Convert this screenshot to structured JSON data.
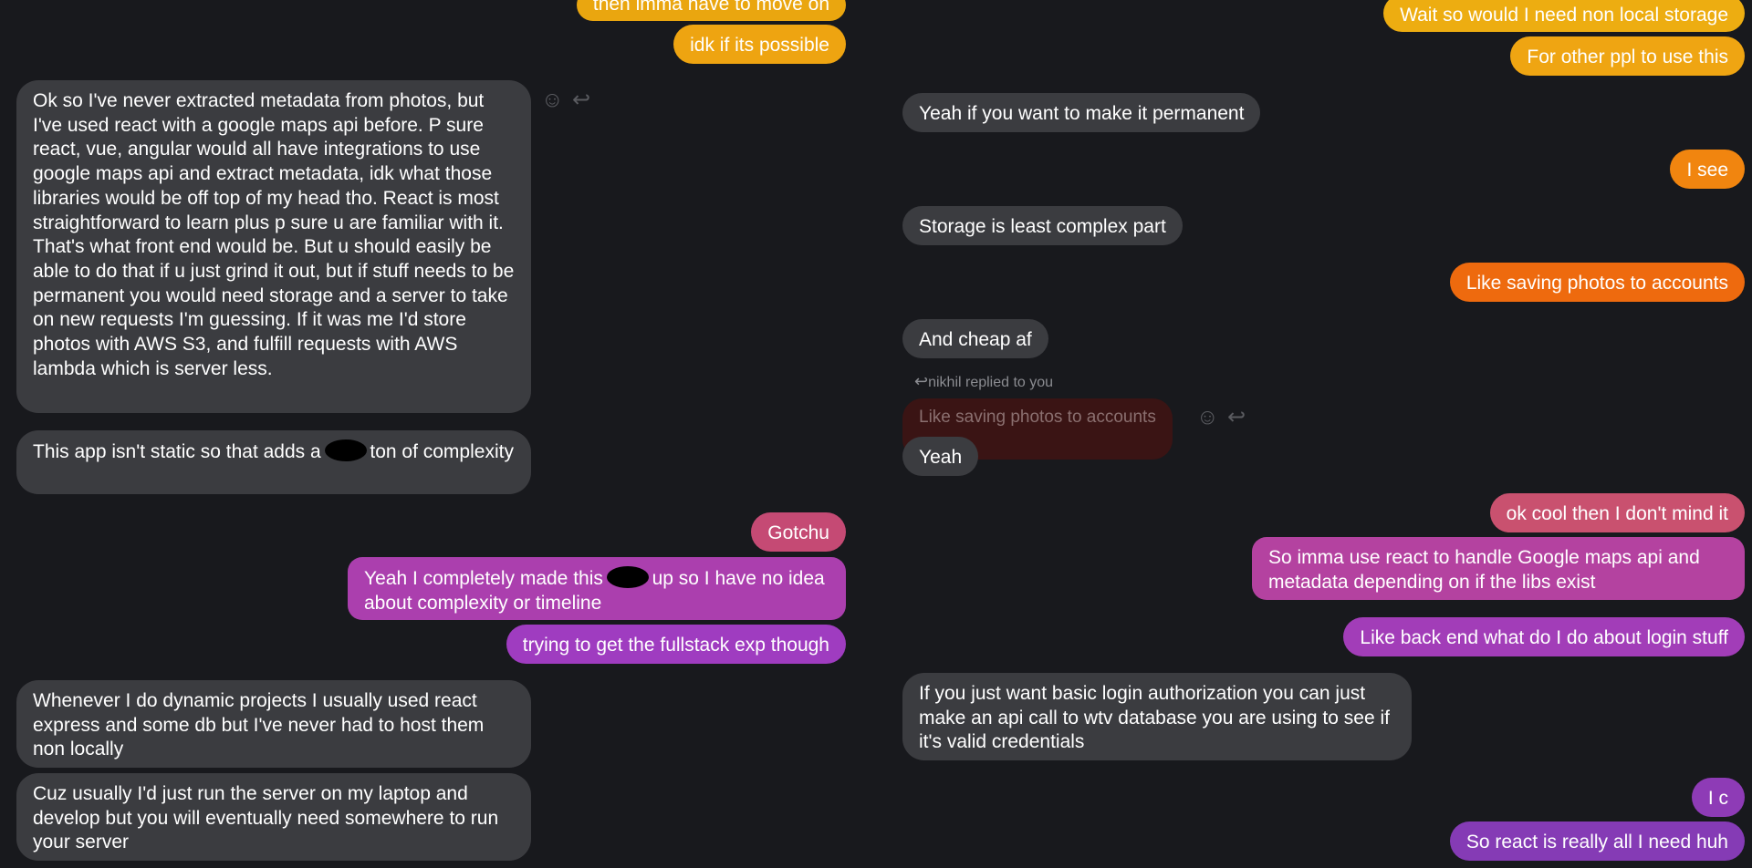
{
  "left_column": {
    "messages": [
      {
        "id": "l1",
        "direction": "out",
        "text": "then imma have to move on",
        "color": "#eaa60f"
      },
      {
        "id": "l2",
        "direction": "out",
        "text": "idk if its possible",
        "color": "#eea411"
      },
      {
        "id": "l3",
        "direction": "in",
        "text": "Ok so I've never extracted metadata from photos, but I've used react with a google maps api before. P sure react, vue, angular would all have integrations to use google maps api and extract metadata, idk what those libraries would be off top of my head tho. React is most straightforward to learn plus p sure u are familiar with it. That's what front end would be. But u should easily be able to do that if u just grind it out, but if stuff needs to be permanent you would need storage and a server to take on new requests I'm guessing. If it was me I'd store photos with AWS S3, and fulfill requests with AWS lambda which is server less."
      },
      {
        "id": "l4",
        "direction": "in",
        "text_before": "This app isn't static so that adds a",
        "text_after": "ton of complexity"
      },
      {
        "id": "l5",
        "direction": "out",
        "text": "Gotchu",
        "color": "#c54a74"
      },
      {
        "id": "l6",
        "direction": "out",
        "text_before": "Yeah I completely made this",
        "text_after": "up so I have no idea about complexity or timeline",
        "color": "#ab3fae"
      },
      {
        "id": "l7",
        "direction": "out",
        "text": "trying to get the fullstack exp though",
        "color": "#9f3cc0"
      },
      {
        "id": "l8",
        "direction": "in",
        "text": "Whenever I do dynamic projects I usually used react express and some db but I've never had to host them non locally"
      },
      {
        "id": "l9",
        "direction": "in",
        "text": "Cuz usually I'd just run the server on my laptop and develop but you will eventually need somewhere to run your server"
      }
    ]
  },
  "right_column": {
    "messages": [
      {
        "id": "r1",
        "direction": "out",
        "text": "Wait so would I need non local storage",
        "color": "#edad11"
      },
      {
        "id": "r2",
        "direction": "out",
        "text": "For other ppl to use this",
        "color": "#efa512"
      },
      {
        "id": "r3",
        "direction": "in",
        "text": "Yeah if you want to make it permanent"
      },
      {
        "id": "r4",
        "direction": "out",
        "text": "I see",
        "color": "#f1850f"
      },
      {
        "id": "r5",
        "direction": "in",
        "text": "Storage is least complex part"
      },
      {
        "id": "r6",
        "direction": "out",
        "text": "Like saving photos to accounts",
        "color": "#ee6a0e"
      },
      {
        "id": "r7",
        "direction": "in",
        "text": "And cheap af"
      },
      {
        "id": "r8",
        "direction": "in",
        "text": "Yeah"
      },
      {
        "id": "r9",
        "direction": "out",
        "text": "ok cool then I don't mind it",
        "color": "#c9516f"
      },
      {
        "id": "r10",
        "direction": "out",
        "text": "So imma use react to handle Google maps api and metadata depending on if the libs exist",
        "color": "#b442a0"
      },
      {
        "id": "r11",
        "direction": "out",
        "text": "Like back end what do I do about login stuff",
        "color": "#a23db8"
      },
      {
        "id": "r12",
        "direction": "in",
        "text": "If you just want basic login authorization you can just make an api call to wtv database you are using to see if it's valid credentials"
      },
      {
        "id": "r13",
        "direction": "out",
        "text": "I c",
        "color": "#8e3bb6"
      },
      {
        "id": "r14",
        "direction": "out",
        "text": "So react is really all I need huh",
        "color": "#853bb5"
      }
    ],
    "reply": {
      "meta": "nikhil replied to you",
      "quoted": "Like saving photos to accounts"
    }
  },
  "icons": {
    "react": "smiley-face",
    "reply": "reply-arrow"
  }
}
